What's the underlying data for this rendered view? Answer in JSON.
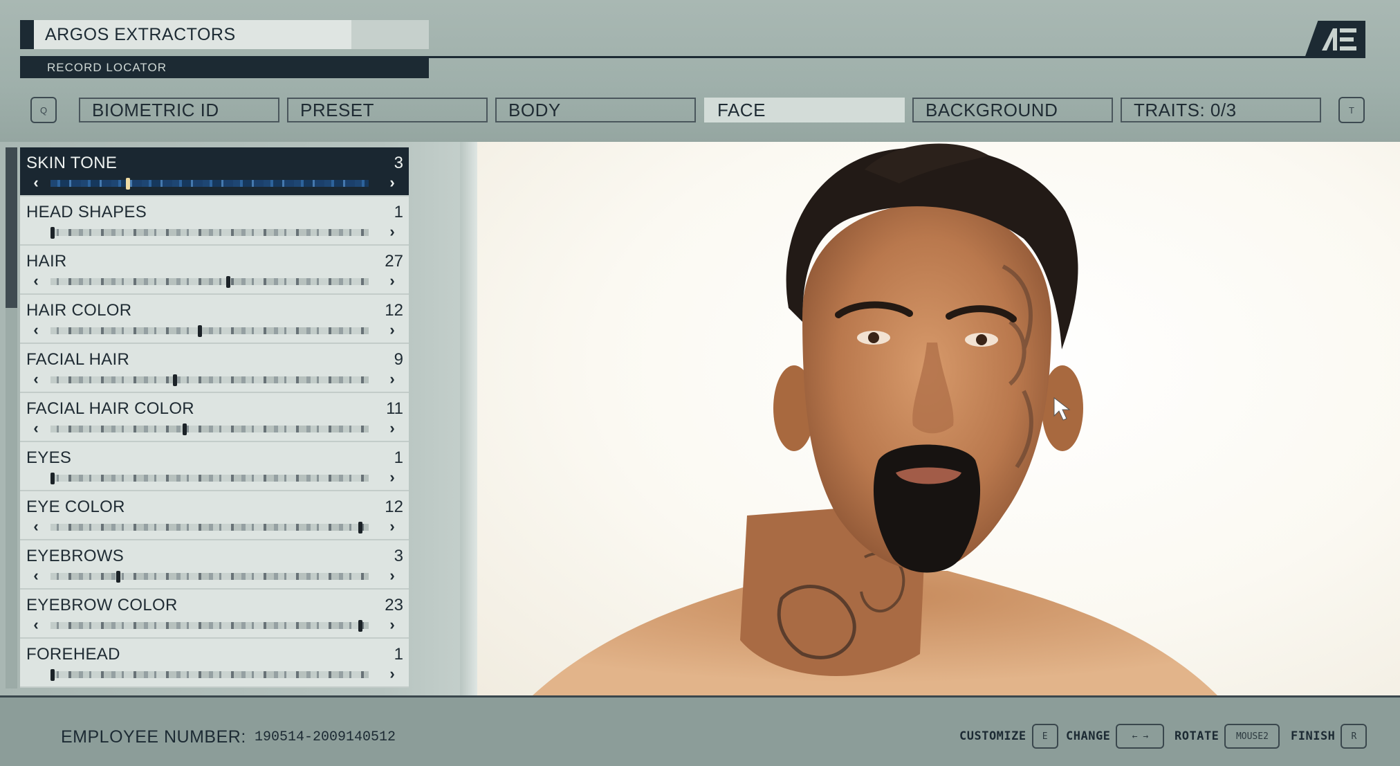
{
  "header": {
    "company_name": "ARGOS EXTRACTORS",
    "record_label": "RECORD LOCATOR",
    "logo_text": "AE",
    "left_key": "Q",
    "right_key": "T"
  },
  "tabs": [
    {
      "label": "BIOMETRIC ID",
      "active": false
    },
    {
      "label": "PRESET",
      "active": false
    },
    {
      "label": "BODY",
      "active": false
    },
    {
      "label": "FACE",
      "active": true
    },
    {
      "label": "BACKGROUND",
      "active": false
    },
    {
      "label": "TRAITS: 0/3",
      "active": false
    }
  ],
  "options": [
    {
      "label": "SKIN TONE",
      "value": "3",
      "position": 0.24,
      "selected": true,
      "left_arrow": true
    },
    {
      "label": "HEAD SHAPES",
      "value": "1",
      "position": 0.0,
      "selected": false,
      "left_arrow": false
    },
    {
      "label": "HAIR",
      "value": "27",
      "position": 0.56,
      "selected": false,
      "left_arrow": true
    },
    {
      "label": "HAIR COLOR",
      "value": "12",
      "position": 0.47,
      "selected": false,
      "left_arrow": true
    },
    {
      "label": "FACIAL HAIR",
      "value": "9",
      "position": 0.39,
      "selected": false,
      "left_arrow": true
    },
    {
      "label": "FACIAL HAIR COLOR",
      "value": "11",
      "position": 0.42,
      "selected": false,
      "left_arrow": true
    },
    {
      "label": "EYES",
      "value": "1",
      "position": 0.0,
      "selected": false,
      "left_arrow": false
    },
    {
      "label": "EYE COLOR",
      "value": "12",
      "position": 0.98,
      "selected": false,
      "left_arrow": true
    },
    {
      "label": "EYEBROWS",
      "value": "3",
      "position": 0.21,
      "selected": false,
      "left_arrow": true
    },
    {
      "label": "EYEBROW COLOR",
      "value": "23",
      "position": 0.98,
      "selected": false,
      "left_arrow": true
    },
    {
      "label": "FOREHEAD",
      "value": "1",
      "position": 0.0,
      "selected": false,
      "left_arrow": false
    }
  ],
  "footer": {
    "employee_label": "EMPLOYEE NUMBER:",
    "employee_number": "190514-2009140512",
    "hints": [
      {
        "label": "CUSTOMIZE",
        "key": "E"
      },
      {
        "label": "CHANGE",
        "key": "← →"
      },
      {
        "label": "ROTATE",
        "key": "MOUSE2"
      },
      {
        "label": "FINISH",
        "key": "R"
      }
    ]
  },
  "colors": {
    "dark_navy": "#1c2a33",
    "panel_light": "#dde4e1",
    "active_tab": "#d3dcd8",
    "skin_tone_thumb": "#f0dca4"
  },
  "icons": {
    "logo": "ae-logo-icon",
    "arrow_left": "chevron-left-icon",
    "arrow_right": "chevron-right-icon",
    "cursor": "mouse-pointer-icon"
  }
}
